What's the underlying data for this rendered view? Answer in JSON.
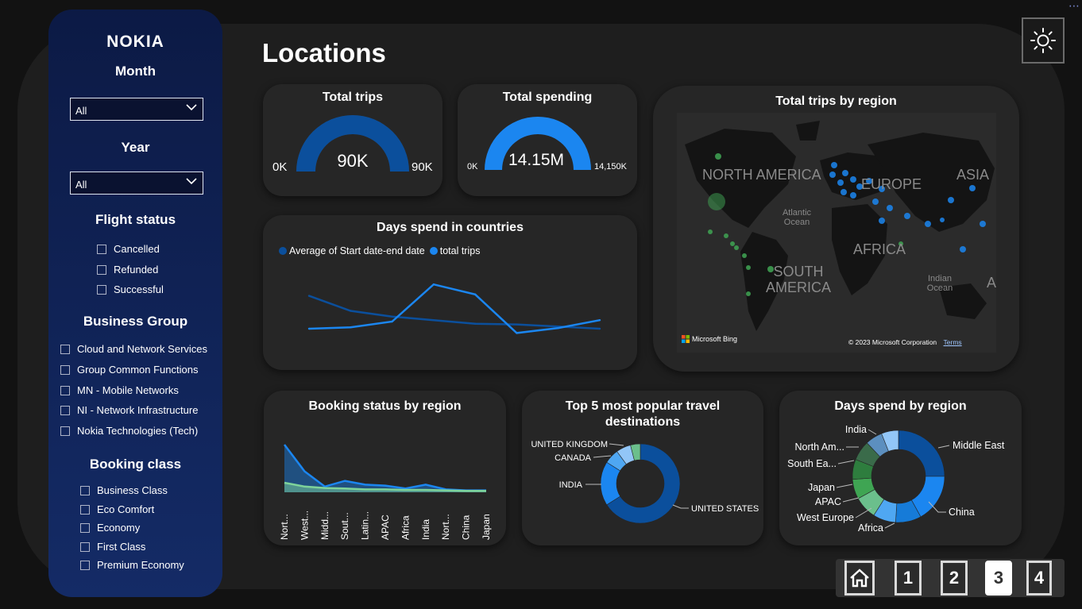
{
  "canvas": {
    "dots": "⋯"
  },
  "sidebar": {
    "logo": "NOKIA",
    "month": {
      "title": "Month",
      "value": "All"
    },
    "year": {
      "title": "Year",
      "value": "All"
    },
    "flight_status": {
      "title": "Flight status",
      "options": [
        "Cancelled",
        "Refunded",
        "Successful"
      ]
    },
    "business_group": {
      "title": "Business Group",
      "options": [
        "Cloud and Network Services",
        "Group Common Functions",
        "MN - Mobile Networks",
        "NI - Network Infrastructure",
        "Nokia Technologies (Tech)"
      ]
    },
    "booking_class": {
      "title": "Booking class",
      "options": [
        "Business Class",
        "Eco Comfort",
        "Economy",
        "First Class",
        "Premium Economy"
      ]
    }
  },
  "page_title": "Locations",
  "total_trips": {
    "title": "Total trips",
    "value": "90K",
    "min": "0K",
    "max": "90K",
    "fill": 1.0
  },
  "total_spending": {
    "title": "Total spending",
    "value": "14.15M",
    "min": "0K",
    "max": "14,150K",
    "fill": 1.0
  },
  "days_spend_countries": {
    "title": "Days spend in countries",
    "legend": [
      "Average of Start date-end date",
      "total trips"
    ],
    "colors": [
      "#0b4f9c",
      "#1b86f0"
    ]
  },
  "map": {
    "title": "Total trips by region",
    "labels": [
      "NORTH AMERICA",
      "EUROPE",
      "ASIA",
      "Atlantic Ocean",
      "AFRICA",
      "SOUTH AMERICA",
      "Indian Ocean",
      "A"
    ],
    "attribution": "Microsoft Bing",
    "copyright": "© 2023 Microsoft Corporation",
    "terms": "Terms"
  },
  "booking_status": {
    "title": "Booking status by region",
    "categories": [
      "Nort...",
      "West...",
      "Midd...",
      "Sout...",
      "Latin...",
      "APAC",
      "Africa",
      "India",
      "Nort...",
      "China",
      "Japan"
    ]
  },
  "top5": {
    "title": "Top 5 most popular travel destinations",
    "labels": [
      "UNITED KINGDOM",
      "CANADA",
      "INDIA",
      "UNITED STATES"
    ]
  },
  "days_region": {
    "title": "Days spend by region",
    "labels": [
      "India",
      "North Am...",
      "South Ea...",
      "Japan",
      "APAC",
      "West Europe",
      "Africa",
      "China",
      "Middle East"
    ]
  },
  "nav": {
    "buttons": [
      "1",
      "2",
      "3",
      "4"
    ],
    "active": "3"
  },
  "icons": {
    "theme": "sun-icon",
    "home": "home-icon",
    "dropdown": "chevron-down-icon"
  },
  "chart_data": [
    {
      "type": "line",
      "title": "Days spend in countries",
      "series": [
        {
          "name": "Average of Start date-end date",
          "values": [
            76,
            55,
            47,
            42,
            37,
            36,
            33,
            30
          ]
        },
        {
          "name": "total trips",
          "values": [
            30,
            32,
            40,
            92,
            78,
            24,
            31,
            42
          ]
        }
      ]
    },
    {
      "type": "area",
      "title": "Booking status by region",
      "categories": [
        "Nort...",
        "West...",
        "Midd...",
        "Sout...",
        "Latin...",
        "APAC",
        "Africa",
        "India",
        "Nort...",
        "China",
        "Japan"
      ],
      "series": [
        {
          "values": [
            100,
            44,
            12,
            24,
            16,
            14,
            8,
            16,
            6,
            4,
            4
          ],
          "color": "#1b86f0"
        },
        {
          "values": [
            20,
            12,
            9,
            8,
            6,
            6,
            5,
            5,
            4,
            3,
            3
          ],
          "color": "#7ed39a"
        }
      ]
    },
    {
      "type": "pie",
      "title": "Top 5 most popular travel destinations",
      "categories": [
        "UNITED STATES",
        "INDIA",
        "CANADA",
        "UNITED KINGDOM",
        "other"
      ],
      "values": [
        66,
        18,
        6,
        6,
        4
      ],
      "colors": [
        "#0b4f9c",
        "#1b86f0",
        "#4fa7f2",
        "#92c6f7",
        "#6bbf8c"
      ]
    },
    {
      "type": "pie",
      "title": "Days spend by region",
      "categories": [
        "Middle East",
        "China",
        "Africa",
        "West Europe",
        "APAC",
        "Japan",
        "South Ea...",
        "North Am...",
        "India",
        "other"
      ],
      "values": [
        25,
        17,
        9,
        8,
        8,
        7,
        7,
        7,
        6,
        6
      ],
      "colors": [
        "#0b4f9c",
        "#1b86f0",
        "#167bd8",
        "#4fa7f2",
        "#6bbf8c",
        "#3fa553",
        "#2e7d3e",
        "#3a6b4a",
        "#5c8fbf",
        "#92c6f7"
      ]
    }
  ]
}
